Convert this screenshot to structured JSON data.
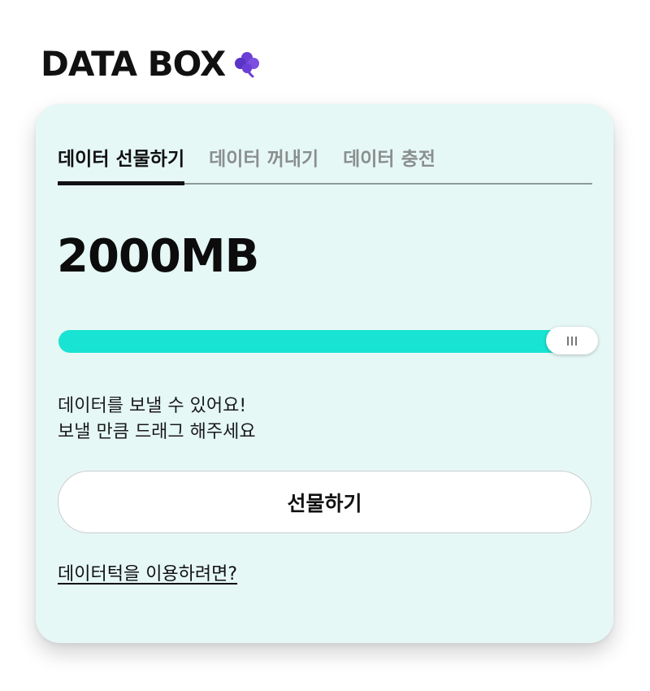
{
  "brand": {
    "title": "DATA BOX",
    "icon": "clover-icon",
    "icon_color": "#6b3fd6"
  },
  "tabs": [
    {
      "label": "데이터 선물하기",
      "active": true
    },
    {
      "label": "데이터 꺼내기",
      "active": false
    },
    {
      "label": "데이터 충전",
      "active": false
    }
  ],
  "amount": "2000MB",
  "slider": {
    "fill_fraction": 1.0,
    "fill_color": "#19e3d2",
    "handle_icon": "grip-icon"
  },
  "hint": {
    "line1": "데이터를 보낼 수 있어요!",
    "line2": "보낼 만큼 드래그 해주세요"
  },
  "gift_button": {
    "label": "선물하기"
  },
  "help_link": {
    "label": "데이터턱을 이용하려면?"
  },
  "colors": {
    "card_background": "#e6f8f6",
    "accent": "#19e3d2",
    "text": "#111111"
  }
}
